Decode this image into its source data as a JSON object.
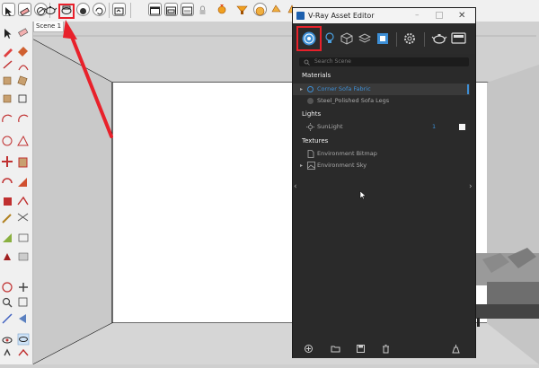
{
  "scene_tab": {
    "label": "Scene 1"
  },
  "vray": {
    "window_title": "V-Ray Asset Editor",
    "search_placeholder": "Search Scene",
    "sections": {
      "materials": "Materials",
      "lights": "Lights",
      "textures": "Textures"
    },
    "materials": [
      {
        "label": "Corner Sofa Fabric",
        "selected": true
      },
      {
        "label": "Steel_Polished Sofa Legs",
        "selected": false
      }
    ],
    "lights": [
      {
        "label": "SunLight",
        "count": "1"
      }
    ],
    "textures": [
      {
        "label": "Environment Bitmap"
      },
      {
        "label": "Environment Sky"
      }
    ]
  },
  "colors": {
    "accent": "#3d8fd6",
    "highlight_box": "#e8212b",
    "arrow": "#e8212b",
    "panel_bg": "#2a2a2a"
  },
  "icons": {
    "top_toolbar": [
      "select-tool-icon",
      "eraser-icon",
      "paint-bucket-icon",
      "render-teapot-icon",
      "vray-asset-editor-icon",
      "light-icon",
      "camera-icon",
      "orbit-icon",
      "pan-icon",
      "zoom-icon",
      "frame-buffer-icon",
      "sun-icon",
      "render-options-icon"
    ],
    "vray_toolbar": [
      "materials-icon",
      "lights-icon",
      "geometry-icon",
      "render-elements-icon",
      "textures-icon",
      "settings-icon",
      "render-icon",
      "frame-buffer-icon"
    ]
  }
}
